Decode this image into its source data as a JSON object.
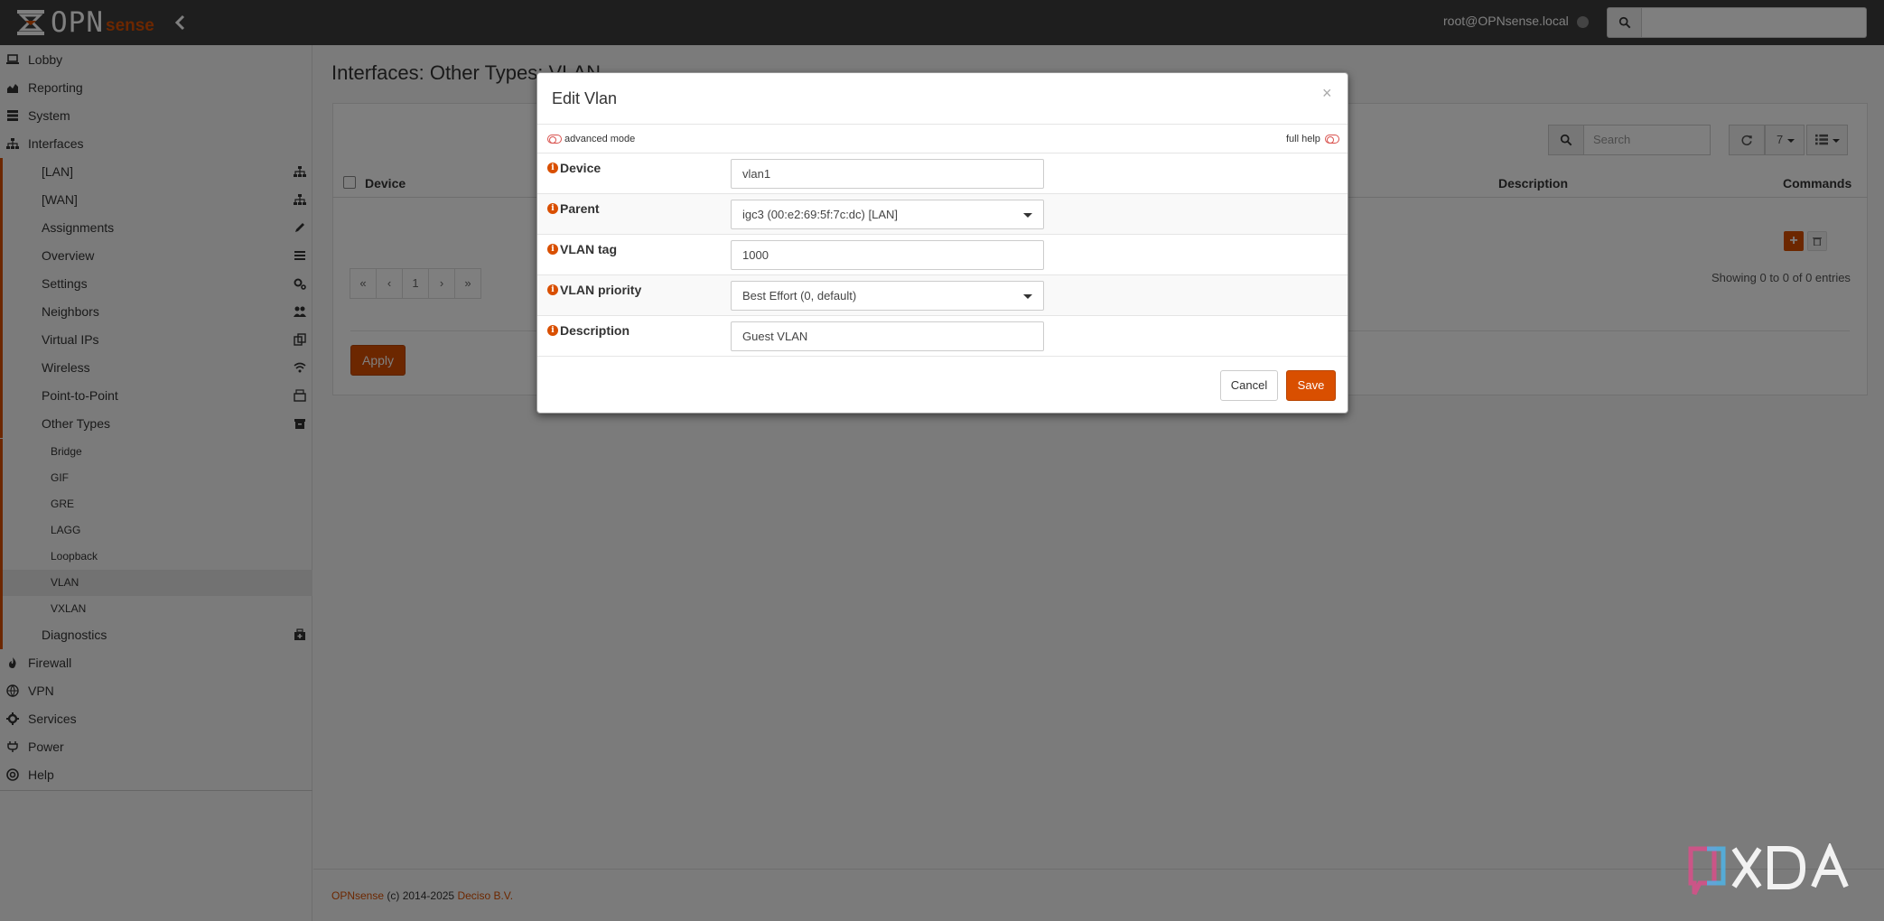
{
  "topbar": {
    "brand_primary": "OPN",
    "brand_secondary": "sense",
    "user": "root@OPNsense.local",
    "search_placeholder": ""
  },
  "sidebar": {
    "items": [
      {
        "label": "Lobby",
        "icon": "laptop-icon",
        "level": 1
      },
      {
        "label": "Reporting",
        "icon": "chart-area-icon",
        "level": 1
      },
      {
        "label": "System",
        "icon": "server-icon",
        "level": 1
      },
      {
        "label": "Interfaces",
        "icon": "sitemap-icon",
        "level": 1
      },
      {
        "label": "[LAN]",
        "icon": "sitemap-icon",
        "level": 2
      },
      {
        "label": "[WAN]",
        "icon": "sitemap-icon",
        "level": 2
      },
      {
        "label": "Assignments",
        "icon": "pencil-icon",
        "level": 2
      },
      {
        "label": "Overview",
        "icon": "tasks-icon",
        "level": 2
      },
      {
        "label": "Settings",
        "icon": "cogs-icon",
        "level": 2
      },
      {
        "label": "Neighbors",
        "icon": "users-icon",
        "level": 2
      },
      {
        "label": "Virtual IPs",
        "icon": "clone-icon",
        "level": 2
      },
      {
        "label": "Wireless",
        "icon": "wifi-icon",
        "level": 2
      },
      {
        "label": "Point-to-Point",
        "icon": "fax-icon",
        "level": 2
      },
      {
        "label": "Other Types",
        "icon": "archive-icon",
        "level": 2
      },
      {
        "label": "Bridge",
        "level": 3
      },
      {
        "label": "GIF",
        "level": 3
      },
      {
        "label": "GRE",
        "level": 3
      },
      {
        "label": "LAGG",
        "level": 3
      },
      {
        "label": "Loopback",
        "level": 3
      },
      {
        "label": "VLAN",
        "level": 3
      },
      {
        "label": "VXLAN",
        "level": 3
      },
      {
        "label": "Diagnostics",
        "icon": "medkit-icon",
        "level": 2
      },
      {
        "label": "Firewall",
        "icon": "fire-icon",
        "level": 1
      },
      {
        "label": "VPN",
        "icon": "globe-icon",
        "level": 1
      },
      {
        "label": "Services",
        "icon": "cog-icon",
        "level": 1
      },
      {
        "label": "Power",
        "icon": "plug-icon",
        "level": 1
      },
      {
        "label": "Help",
        "icon": "support-icon",
        "level": 1
      }
    ]
  },
  "main": {
    "title": "Interfaces: Other Types: VLAN",
    "grid": {
      "search_placeholder": "Search",
      "rows_per_page": "7",
      "columns": [
        "Device",
        "Description",
        "Commands"
      ],
      "pager": [
        "«",
        "‹",
        "1",
        "›",
        "»"
      ],
      "showing": "Showing 0 to 0 of 0 entries"
    },
    "apply_label": "Apply",
    "footer_brand": "OPNsense",
    "footer_copy": "(c) 2014-2025",
    "footer_company": "Deciso B.V."
  },
  "modal": {
    "title": "Edit Vlan",
    "close": "×",
    "advanced_mode": "advanced mode",
    "full_help": "full help",
    "fields": [
      {
        "label": "Device",
        "value": "vlan1",
        "type": "text"
      },
      {
        "label": "Parent",
        "value": "igc3 (00:e2:69:5f:7c:dc) [LAN]",
        "type": "select"
      },
      {
        "label": "VLAN tag",
        "value": "1000",
        "type": "text"
      },
      {
        "label": "VLAN priority",
        "value": "Best Effort (0, default)",
        "type": "select"
      },
      {
        "label": "Description",
        "value": "Guest VLAN",
        "type": "text"
      }
    ],
    "cancel_label": "Cancel",
    "save_label": "Save"
  },
  "colors": {
    "accent": "#d94f00",
    "topbar": "#3c3c3c"
  }
}
